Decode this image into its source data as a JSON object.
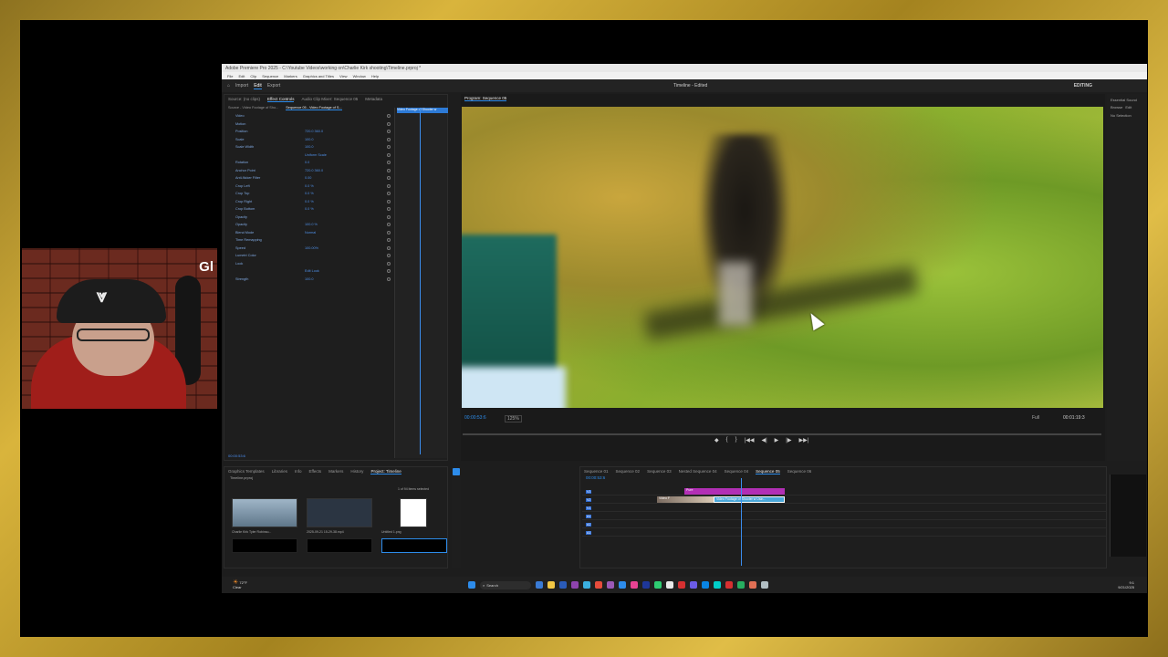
{
  "window": {
    "title": "Adobe Premiere Pro 2025 - C:\\Youtube Videos\\working on\\Charlie Kirk shooting\\Timeline.prproj *",
    "menu": [
      "File",
      "Edit",
      "Clip",
      "Sequence",
      "Markers",
      "Graphics and Titles",
      "View",
      "Window",
      "Help"
    ],
    "workspaces": [
      "Import",
      "Edit",
      "Export"
    ],
    "active_workspace": "Edit",
    "center_title": "Timeline - Edited",
    "right_label": "EDITING"
  },
  "webcam": {
    "overlay_text": "Gl"
  },
  "effect_controls": {
    "tabs": [
      "Source: (no clips)",
      "Effect Controls",
      "Audio Clip Mixer: Sequence 05",
      "Metadata"
    ],
    "active_tab": "Effect Controls",
    "source_label": "Source - Video Footage of Sho...",
    "sequence_label": "Sequence 05 - Video Footage of S...",
    "clip_label": "Video Footage of Shooter w",
    "rows": [
      {
        "label": "Video",
        "value": ""
      },
      {
        "label": "Motion",
        "value": ""
      },
      {
        "label": "Position",
        "value": "720.0  360.0"
      },
      {
        "label": "Scale",
        "value": "100.0"
      },
      {
        "label": "Scale Width",
        "value": "100.0"
      },
      {
        "label": "",
        "value": "Uniform Scale"
      },
      {
        "label": "Rotation",
        "value": "0.0"
      },
      {
        "label": "Anchor Point",
        "value": "720.0  360.0"
      },
      {
        "label": "Anti-flicker Filter",
        "value": "0.00"
      },
      {
        "label": "Crop Left",
        "value": "0.0 %"
      },
      {
        "label": "Crop Top",
        "value": "0.0 %"
      },
      {
        "label": "Crop Right",
        "value": "0.0 %"
      },
      {
        "label": "Crop Bottom",
        "value": "0.0 %"
      },
      {
        "label": "Opacity",
        "value": ""
      },
      {
        "label": "Opacity",
        "value": "100.0 %"
      },
      {
        "label": "Blend Mode",
        "value": "Normal"
      },
      {
        "label": "Time Remapping",
        "value": ""
      },
      {
        "label": "Speed",
        "value": "100.00%"
      },
      {
        "label": "Lumetri Color",
        "value": ""
      },
      {
        "label": "Look",
        "value": ""
      },
      {
        "label": "",
        "value": "Edit Look"
      },
      {
        "label": "Strength",
        "value": "100.0"
      }
    ],
    "timecode": "00:00:53:6"
  },
  "program_monitor": {
    "title": "Program: Sequence 05",
    "timecode_left": "00:00:53:6",
    "zoom": "125%",
    "quality": "Full",
    "timecode_right": "00:01:19:3",
    "transport": [
      "◆",
      "{",
      "}",
      "|◀◀",
      "◀|",
      "▶",
      "|▶",
      "▶▶|"
    ]
  },
  "side_panel": {
    "tabs": [
      "Essential Sound",
      "Browse",
      "Edit"
    ],
    "message": "No Selection"
  },
  "project": {
    "tabs": [
      "Graphics Templates",
      "Libraries",
      "Info",
      "Effects",
      "Markers",
      "History",
      "Project: Timeline"
    ],
    "active_tab": "Project: Timeline",
    "project_name": "Timeline.prproj",
    "selection_info": "1 of 94 items selected",
    "items": [
      {
        "name": "Charlie Kirk Tyler Robinso...",
        "duration": "7:11:00"
      },
      {
        "name": "2025-09-21 15-29-38.mp4",
        "duration": "10:0"
      },
      {
        "name": "Untitled 1.png",
        "duration": "10:0"
      }
    ]
  },
  "timeline": {
    "sequence_tabs": [
      "Sequence 01",
      "Sequence 02",
      "Sequence 03",
      "Nested Sequence 04",
      "Sequence 04",
      "Sequence 05",
      "Sequence 06"
    ],
    "active_sequence": "Sequence 05",
    "timecode": "00:00:53:6",
    "tracks": [
      "V3",
      "V2",
      "V1",
      "A1",
      "A2",
      "A3"
    ],
    "clips": [
      {
        "track": "V3",
        "label": "Pure",
        "color": "purple"
      },
      {
        "track": "V2",
        "label": "Video F",
        "color": "thumb"
      },
      {
        "track": "V2",
        "label": "Video Footage of Shooter w Usin...",
        "color": "blue"
      }
    ]
  },
  "taskbar": {
    "weather_temp": "72°F",
    "weather_desc": "Clear",
    "search_placeholder": "Search",
    "tray_time": "9:1",
    "tray_date": "9/21/2025"
  }
}
